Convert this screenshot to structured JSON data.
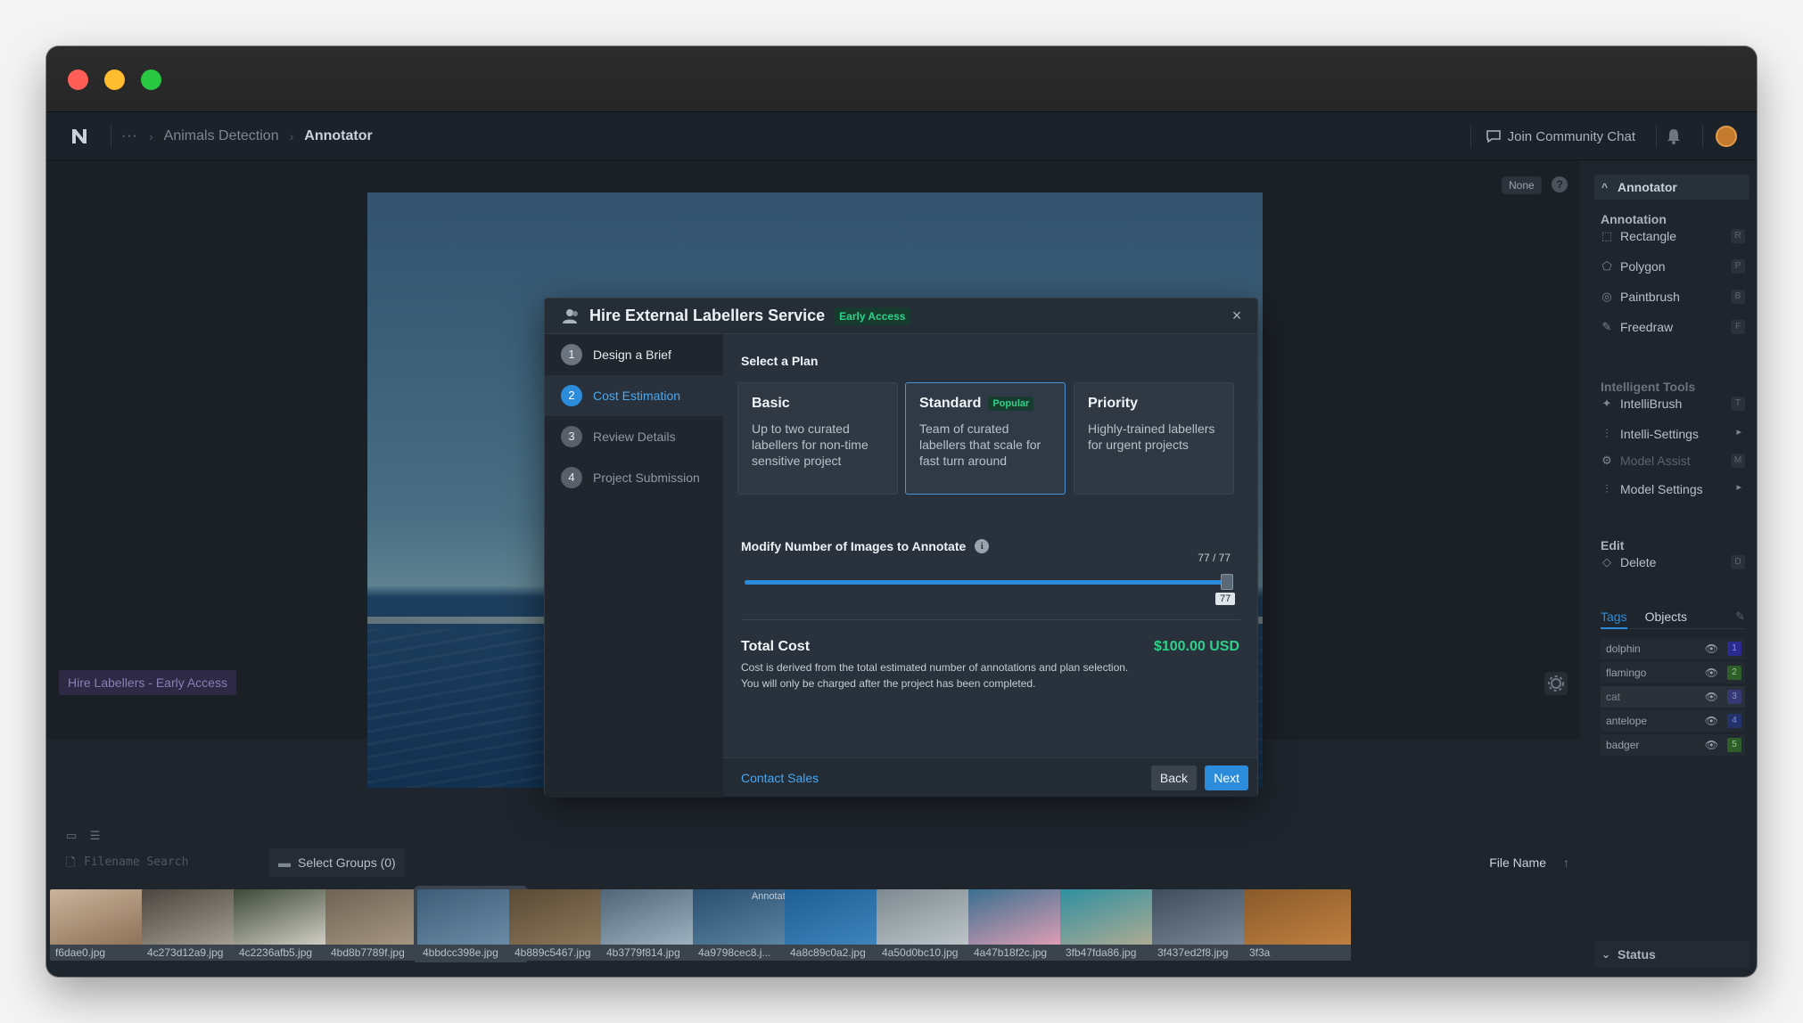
{
  "app": {
    "breadcrumb": {
      "overflow": "···",
      "project": "Animals Detection",
      "current": "Annotator"
    },
    "header_actions": {
      "community": "Join Community Chat"
    }
  },
  "canvas": {
    "zoom_chip": "None",
    "help": "?",
    "hire_chip": "Hire Labellers - Early Access"
  },
  "modal": {
    "title": "Hire External Labellers Service",
    "badge": "Early Access",
    "close": "×",
    "steps": [
      {
        "num": "1",
        "label": "Design a Brief"
      },
      {
        "num": "2",
        "label": "Cost Estimation"
      },
      {
        "num": "3",
        "label": "Review Details"
      },
      {
        "num": "4",
        "label": "Project Submission"
      }
    ],
    "select_plan": "Select a Plan",
    "plans": [
      {
        "name": "Basic",
        "desc": "Up to two curated labellers for non-time sensitive project"
      },
      {
        "name": "Standard",
        "badge": "Popular",
        "desc": "Team of curated labellers that scale for fast turn around"
      },
      {
        "name": "Priority",
        "desc": "Highly-trained labellers for urgent projects"
      }
    ],
    "modify_label": "Modify Number of Images to Annotate",
    "info": "i",
    "count_display": "77 / 77",
    "slider_value": 77,
    "slider_max": 77,
    "slider_tip": "77",
    "total_label": "Total Cost",
    "total_value": "$100.00 USD",
    "total_desc": "Cost is derived from the total estimated number of annotations and plan selection. You will only be charged after the project has been completed.",
    "contact": "Contact Sales",
    "back": "Back",
    "next": "Next"
  },
  "sidebar": {
    "header": "Annotator",
    "annotation_title": "Annotation",
    "annotation_tools": [
      {
        "label": "Rectangle",
        "key": "R",
        "icon": "⬚"
      },
      {
        "label": "Polygon",
        "key": "P",
        "icon": "⬠"
      },
      {
        "label": "Paintbrush",
        "key": "B",
        "icon": "◎"
      },
      {
        "label": "Freedraw",
        "key": "F",
        "icon": "✎"
      }
    ],
    "intelligent_title": "Intelligent Tools",
    "intelligent_tools": [
      {
        "label": "IntelliBrush",
        "key": "T",
        "icon": "✦"
      },
      {
        "label": "Intelli-Settings",
        "icon": "⫶"
      },
      {
        "label": "Model Assist",
        "key": "M",
        "icon": "⚙"
      },
      {
        "label": "Model Settings",
        "icon": "⫶"
      }
    ],
    "edit_title": "Edit",
    "edit_tools": [
      {
        "label": "Delete",
        "key": "D",
        "icon": "◇"
      }
    ],
    "tabs": {
      "tags": "Tags",
      "objects": "Objects"
    },
    "tags": [
      {
        "label": "dolphin",
        "num": "1",
        "color": "#2b2a8e",
        "text": "#8b8cf0"
      },
      {
        "label": "flamingo",
        "num": "2",
        "color": "#2f5e2a",
        "text": "#8bd07f"
      },
      {
        "label": "cat",
        "num": "3",
        "color": "#353a72",
        "text": "#8b8fd0"
      },
      {
        "label": "antelope",
        "num": "4",
        "color": "#23326b",
        "text": "#7a92e0"
      },
      {
        "label": "badger",
        "num": "5",
        "color": "#2f5e2a",
        "text": "#8bd07f"
      }
    ],
    "status": "Status"
  },
  "filmstrip": {
    "search_placeholder": "Filename Search",
    "groups": "Select Groups (0)",
    "sort": "File Name",
    "annotated_label": "Annotated",
    "thumbs": [
      {
        "name": "f6dae0.jpg",
        "colors": [
          "#c9b39a",
          "#8b6e55"
        ]
      },
      {
        "name": "4c273d12a9.jpg",
        "colors": [
          "#4a463f",
          "#a9a397"
        ]
      },
      {
        "name": "4c2236afb5.jpg",
        "colors": [
          "#3d4a38",
          "#d9d5cc"
        ]
      },
      {
        "name": "4bd8b7789f.jpg",
        "colors": [
          "#6f6355",
          "#a99a84"
        ]
      },
      {
        "name": "4bbdcc398e.jpg",
        "colors": [
          "#3d5d78",
          "#6d8ea8"
        ]
      },
      {
        "name": "4b889c5467.jpg",
        "colors": [
          "#5a4a35",
          "#8f7a5c"
        ]
      },
      {
        "name": "4b3779f814.jpg",
        "colors": [
          "#4f6678",
          "#a3b6c4"
        ]
      },
      {
        "name": "4a9798cec8.j...",
        "colors": [
          "#2a4f6f",
          "#5f86a3"
        ],
        "annotated": true
      },
      {
        "name": "4a8c89c0a2.jpg",
        "colors": [
          "#1e5f95",
          "#3f86bd"
        ]
      },
      {
        "name": "4a50d0bc10.jpg",
        "colors": [
          "#7e8a90",
          "#c0c8cc"
        ]
      },
      {
        "name": "4a47b18f2c.jpg",
        "colors": [
          "#3a6f8f",
          "#e7a0b6"
        ]
      },
      {
        "name": "3fb47fda86.jpg",
        "colors": [
          "#2f8fa0",
          "#b5ad92"
        ]
      },
      {
        "name": "3f437ed2f8.jpg",
        "colors": [
          "#3e4c5c",
          "#7d8b98"
        ]
      },
      {
        "name": "3f3a",
        "colors": [
          "#8a5a2a",
          "#c08040"
        ]
      }
    ]
  }
}
